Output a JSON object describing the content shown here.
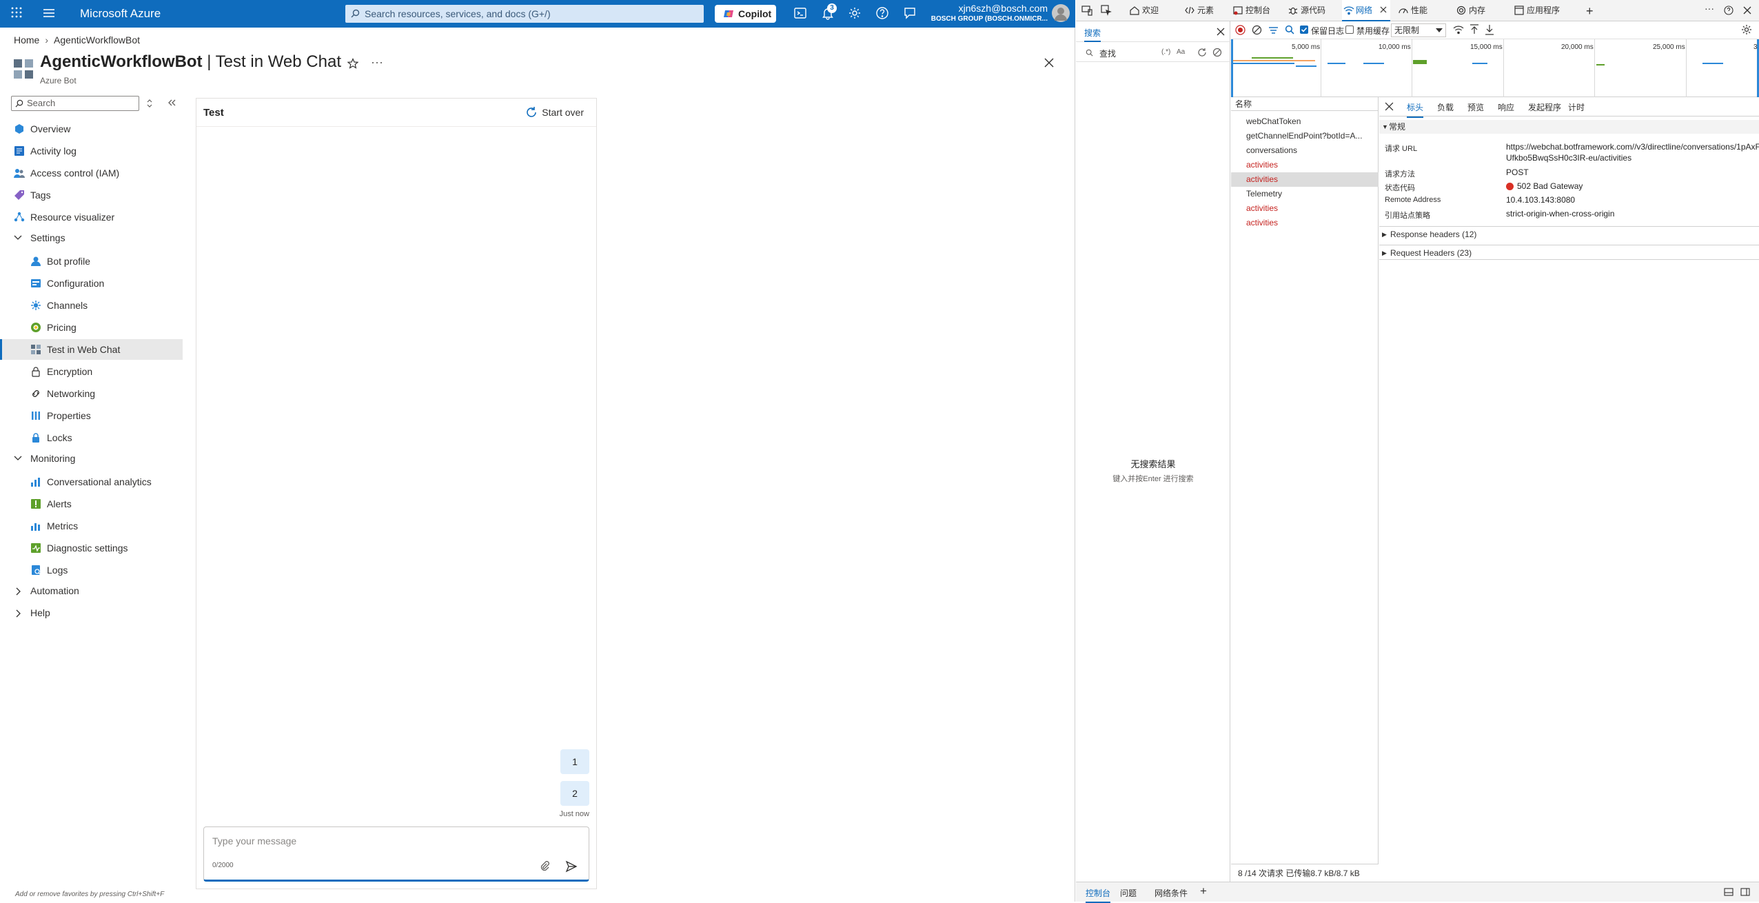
{
  "portal": {
    "brand": "Microsoft Azure",
    "search_placeholder": "Search resources, services, and docs (G+/)",
    "copilot_label": "Copilot",
    "notification_count": "3",
    "account_email": "xjn6szh@bosch.com",
    "account_org": "BOSCH GROUP (BOSCH.ONMICR...",
    "breadcrumb": [
      "Home",
      "AgenticWorkflowBot"
    ],
    "title_main": "AgenticWorkflowBot",
    "title_rest": " | Test in Web Chat",
    "subtitle": "Azure Bot",
    "nav_search_placeholder": "Search",
    "nav": {
      "overview": "Overview",
      "activity_log": "Activity log",
      "iam": "Access control (IAM)",
      "tags": "Tags",
      "resource_visualizer": "Resource visualizer",
      "settings": "Settings",
      "bot_profile": "Bot profile",
      "configuration": "Configuration",
      "channels": "Channels",
      "pricing": "Pricing",
      "test_web_chat": "Test in Web Chat",
      "encryption": "Encryption",
      "networking": "Networking",
      "properties": "Properties",
      "locks": "Locks",
      "monitoring": "Monitoring",
      "conv_analytics": "Conversational analytics",
      "alerts": "Alerts",
      "metrics": "Metrics",
      "diag_settings": "Diagnostic settings",
      "logs": "Logs",
      "automation": "Automation",
      "help": "Help"
    },
    "chat": {
      "title": "Test",
      "start_over": "Start over",
      "messages": [
        "1",
        "2"
      ],
      "timestamp": "Just now",
      "input_placeholder": "Type your message",
      "char_count": "0/2000"
    },
    "fav_hint": "Add or remove favorites by pressing Ctrl+Shift+F"
  },
  "devtools": {
    "tabs": [
      "欢迎",
      "元素",
      "控制台",
      "源代码",
      "网络",
      "性能",
      "内存",
      "应用程序"
    ],
    "search_tab": "搜索",
    "find_placeholder": "查找",
    "find_regex": "(.*)",
    "find_case": "Aa",
    "no_results": "无搜索结果",
    "no_results_hint": "键入并按Enter 进行搜索",
    "preserve_log": "保留日志",
    "disable_cache": "禁用缓存",
    "throttling": "无限制",
    "overview_ticks": [
      "5,000 ms",
      "10,000 ms",
      "15,000 ms",
      "20,000 ms",
      "25,000 ms",
      "30"
    ],
    "name_header": "名称",
    "requests": [
      {
        "name": "webChatToken",
        "error": false
      },
      {
        "name": "getChannelEndPoint?botId=A...",
        "error": false
      },
      {
        "name": "conversations",
        "error": false
      },
      {
        "name": "activities",
        "error": true
      },
      {
        "name": "activities",
        "error": true
      },
      {
        "name": "Telemetry",
        "error": false
      },
      {
        "name": "activities",
        "error": true
      },
      {
        "name": "activities",
        "error": true
      }
    ],
    "status_bar": "8 /14 次请求  已传输8.7 kB/8.7 kB",
    "detail_tabs": [
      "标头",
      "负载",
      "预览",
      "响应",
      "发起程序",
      "计时"
    ],
    "general_label": "常规",
    "general": {
      "url_k": "请求 URL",
      "url_v": "https://webchat.botframework.com//v3/directline/conversations/1pAxFUfkbo5BwqSsH0c3IR-eu/activities",
      "method_k": "请求方法",
      "method_v": "POST",
      "status_k": "状态代码",
      "status_v": "502 Bad Gateway",
      "remote_k": "Remote Address",
      "remote_v": "10.4.103.143:8080",
      "policy_k": "引用站点策略",
      "policy_v": "strict-origin-when-cross-origin"
    },
    "response_headers": "Response headers (12)",
    "request_headers": "Request Headers (23)",
    "bottom_tabs": [
      "控制台",
      "问题",
      "网络条件"
    ]
  }
}
